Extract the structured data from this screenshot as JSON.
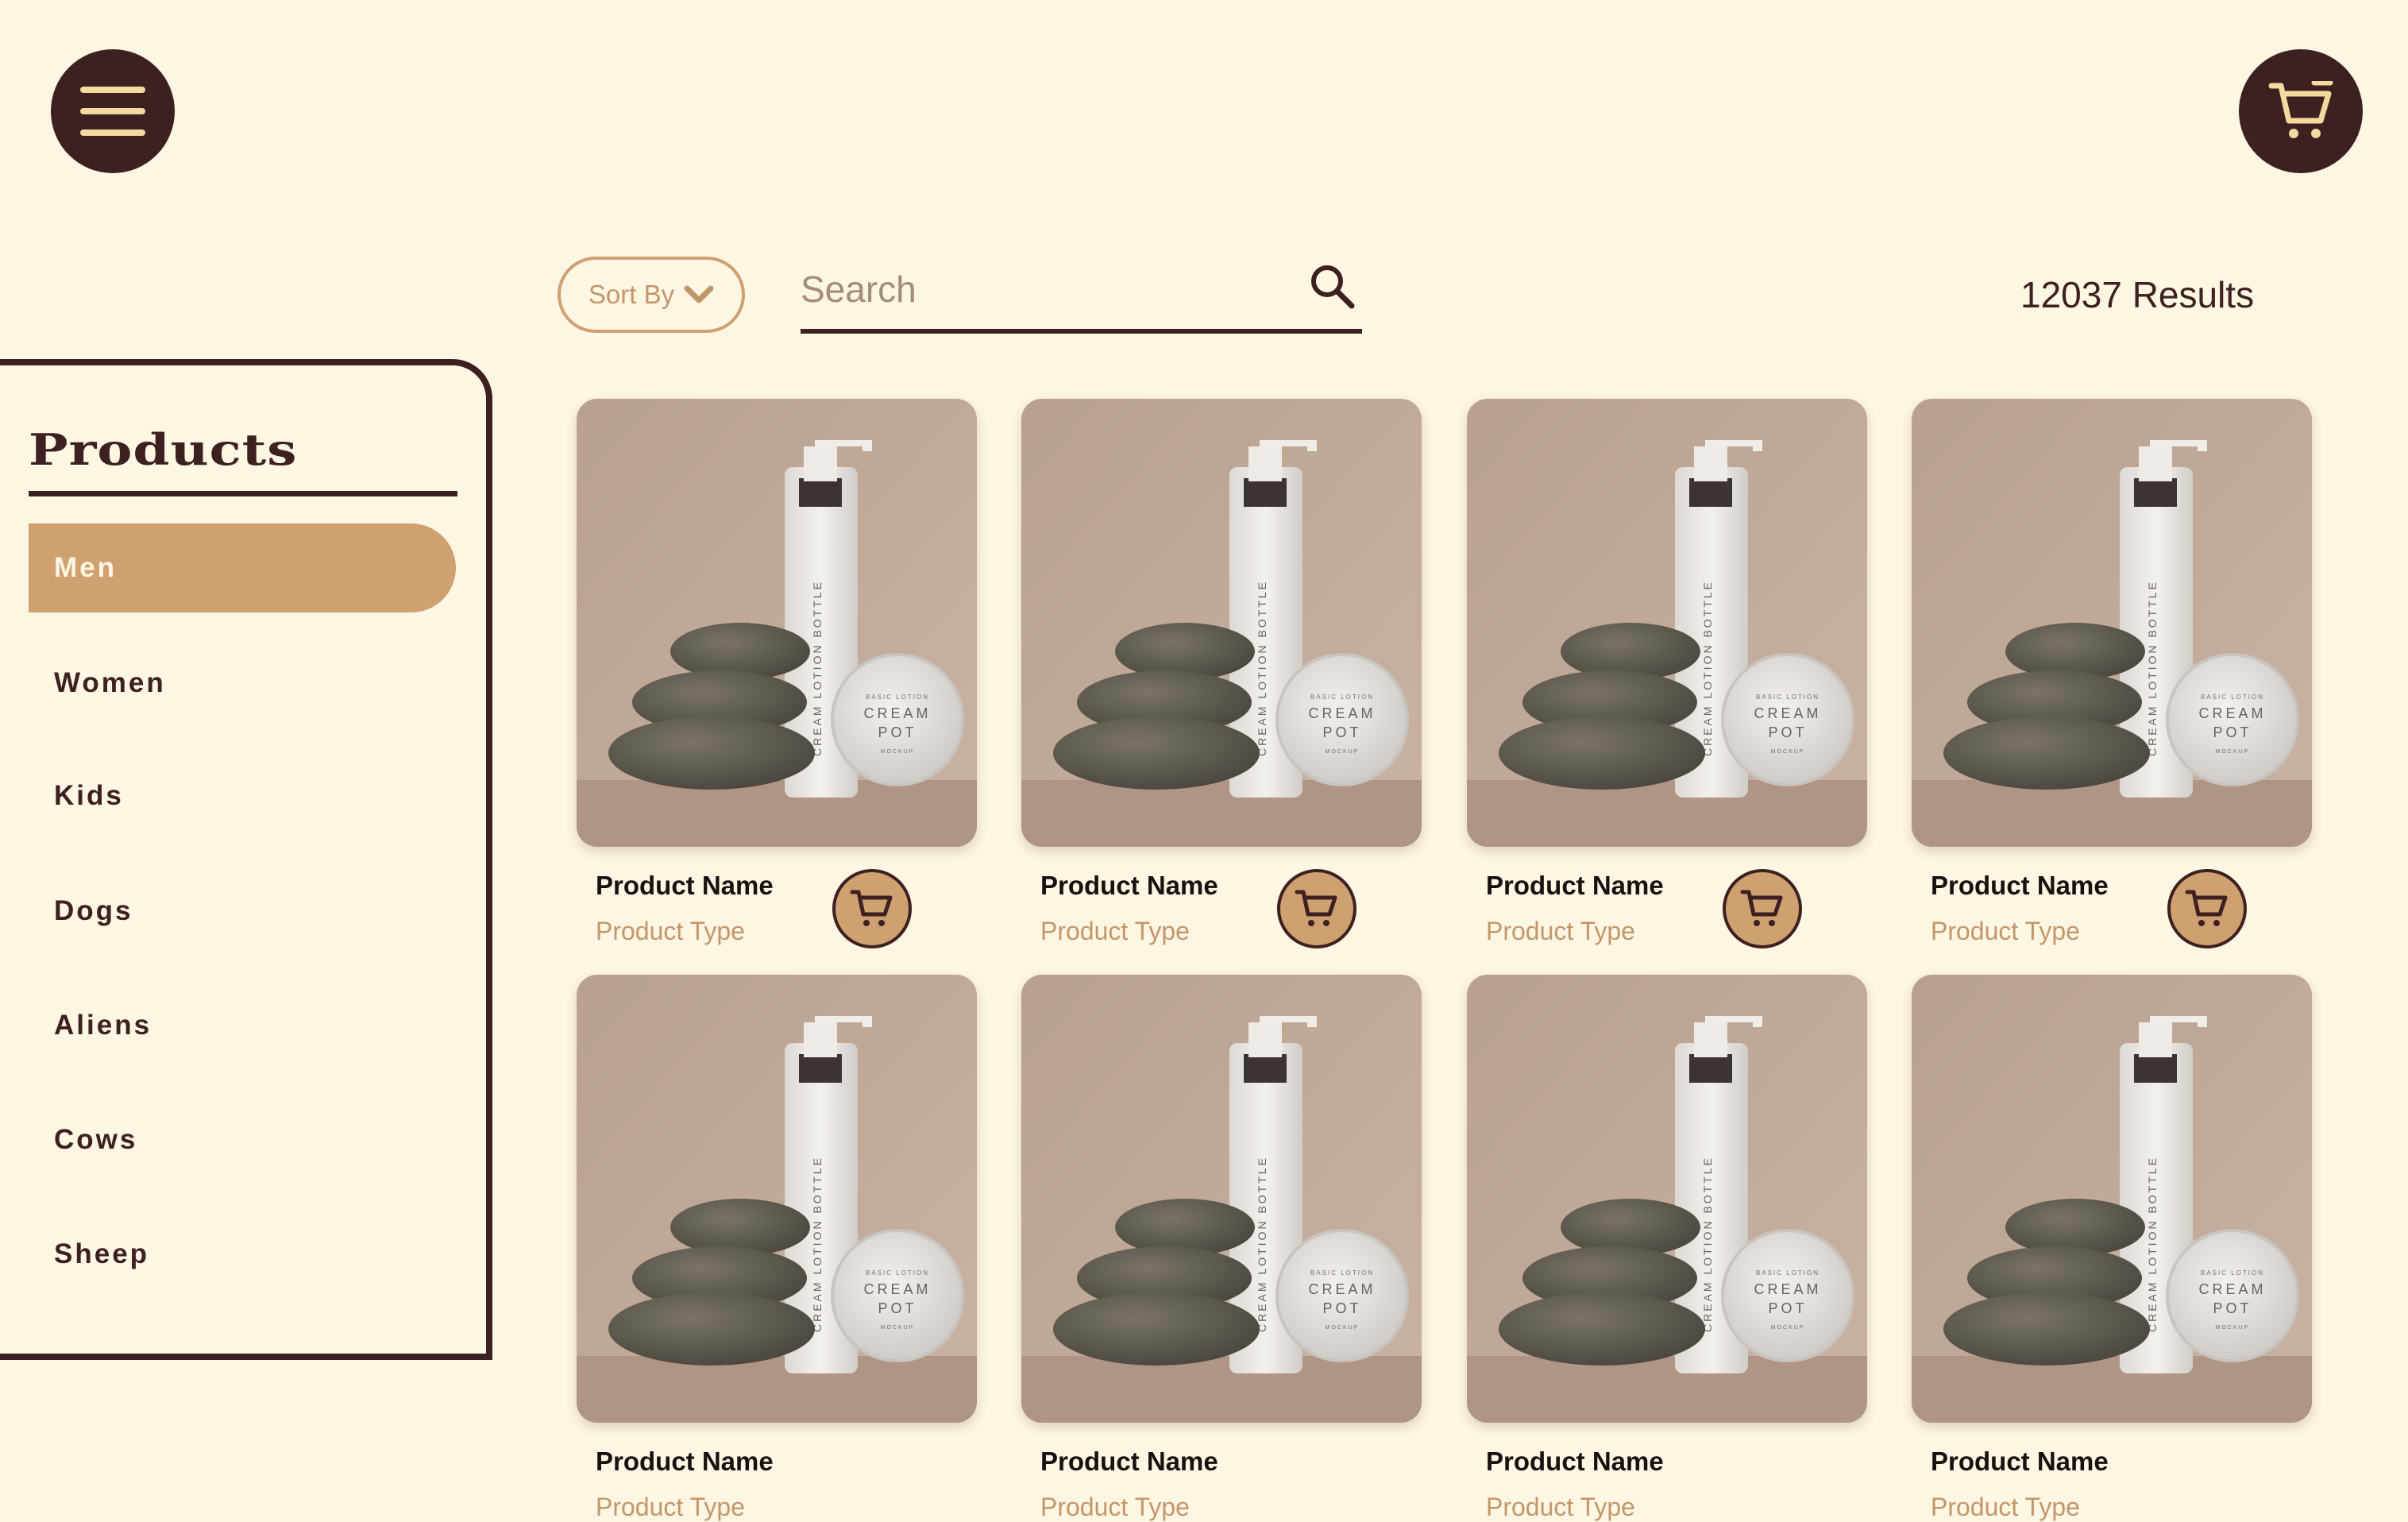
{
  "header": {
    "menu_icon": "hamburger-menu-icon",
    "cart_icon": "shopping-cart-icon"
  },
  "toolbar": {
    "sort_label": "Sort By",
    "search_placeholder": "Search",
    "results_text": "12037 Results"
  },
  "sidebar": {
    "title": "Products",
    "categories": [
      {
        "label": "Men",
        "active": true
      },
      {
        "label": "Women",
        "active": false
      },
      {
        "label": "Kids",
        "active": false
      },
      {
        "label": "Dogs",
        "active": false
      },
      {
        "label": "Aliens",
        "active": false
      },
      {
        "label": "Cows",
        "active": false
      },
      {
        "label": "Sheep",
        "active": false
      }
    ]
  },
  "products": [
    {
      "name": "Product Name",
      "type": "Product Type"
    },
    {
      "name": "Product Name",
      "type": "Product Type"
    },
    {
      "name": "Product Name",
      "type": "Product Type"
    },
    {
      "name": "Product Name",
      "type": "Product Type"
    },
    {
      "name": "Product Name",
      "type": "Product Type"
    },
    {
      "name": "Product Name",
      "type": "Product Type"
    },
    {
      "name": "Product Name",
      "type": "Product Type"
    },
    {
      "name": "Product Name",
      "type": "Product Type"
    }
  ],
  "product_image": {
    "bottle_label": "CREAM LOTION BOTTLE",
    "pot_label_top": "BASIC LOTION",
    "pot_label_1": "CREAM",
    "pot_label_2": "POT",
    "pot_label_bottom": "MOCKUP"
  },
  "colors": {
    "background": "#fdf6e3",
    "dark_brown": "#3d2020",
    "accent_tan": "#cfa070",
    "muted_text": "#c3966a"
  }
}
